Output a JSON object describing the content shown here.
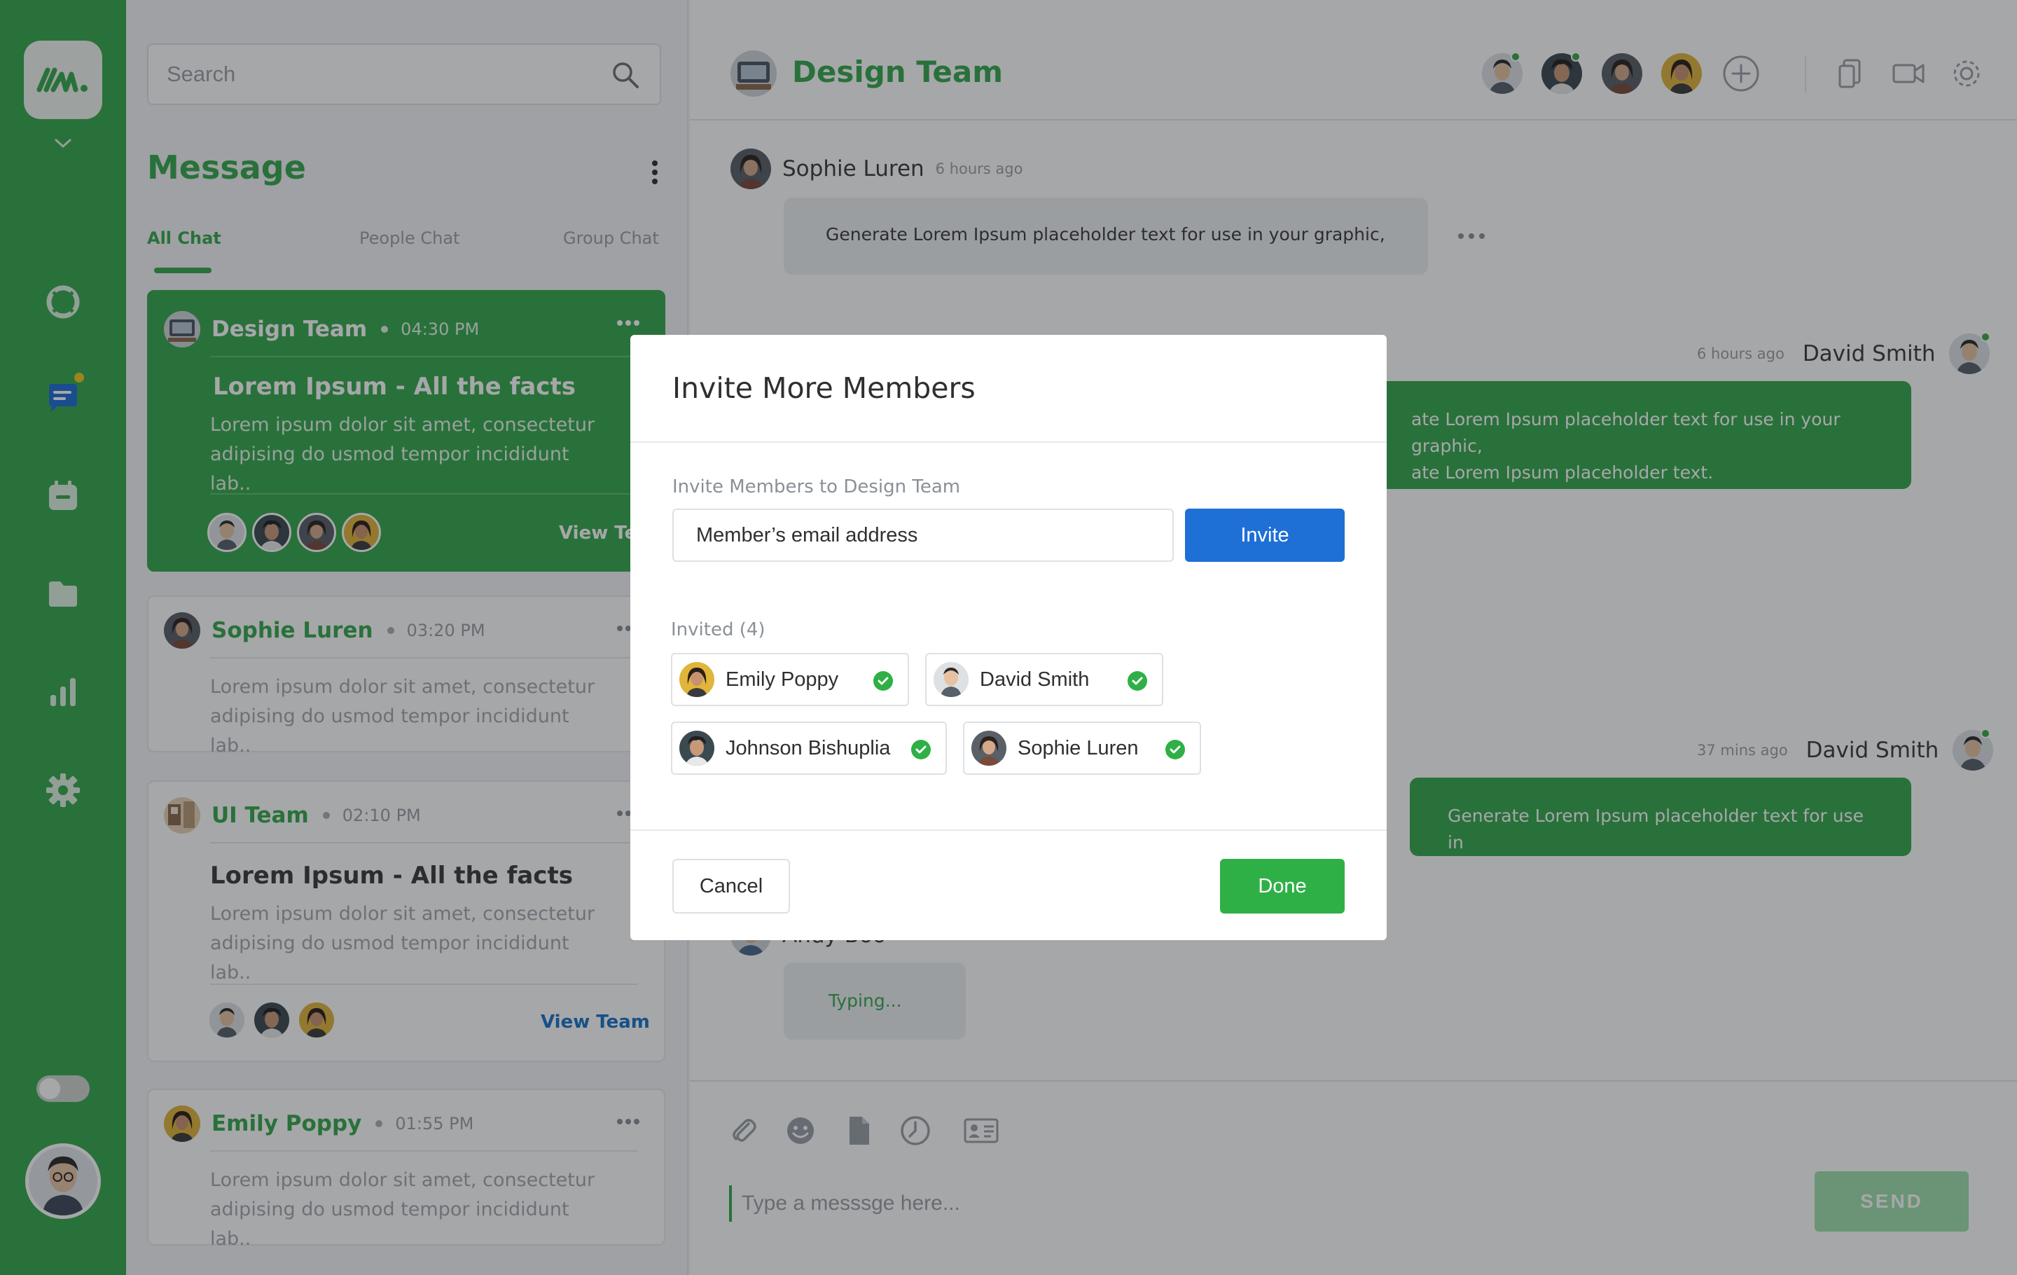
{
  "app": {
    "brand_color": "#36a84d",
    "accent_blue": "#1e6fd6"
  },
  "rail": {
    "logo": "brand-logo",
    "icons": [
      "support-icon",
      "chat-icon",
      "calendar-icon",
      "folder-icon",
      "chart-icon",
      "gear-icon"
    ],
    "active": "chat-icon",
    "theme_toggle": "off"
  },
  "sidebar": {
    "search_placeholder": "Search",
    "title": "Message",
    "tabs": [
      {
        "label": "All Chat",
        "active": true
      },
      {
        "label": "People Chat",
        "active": false
      },
      {
        "label": "Group Chat",
        "active": false
      }
    ],
    "cards": [
      {
        "name": "Design Team",
        "time": "04:30 PM",
        "subject": "Lorem Ipsum - All the facts",
        "body": "Lorem ipsum dolor sit amet, consectetur adipising do usmod tempor incididunt lab..",
        "link": "View Team",
        "active": true
      },
      {
        "name": "Sophie Luren",
        "time": "03:20 PM",
        "body": "Lorem ipsum dolor sit amet, consectetur adipising do usmod tempor incididunt lab.."
      },
      {
        "name": "UI Team",
        "time": "02:10 PM",
        "subject": "Lorem Ipsum - All the facts",
        "body": "Lorem ipsum dolor sit amet, consectetur adipising do usmod tempor incididunt lab..",
        "link": "View Team"
      },
      {
        "name": "Emily Poppy",
        "time": "01:55 PM",
        "body": "Lorem ipsum dolor sit amet, consectetur adipising do usmod tempor incididunt lab.."
      }
    ]
  },
  "chat": {
    "title": "Design Team",
    "header_icons": [
      "add-member-icon",
      "copy-icon",
      "video-icon",
      "settings-icon"
    ],
    "messages": [
      {
        "sender": "Sophie Luren",
        "ago": "6 hours ago",
        "text": "Generate Lorem Ipsum placeholder text for use in your graphic,"
      },
      {
        "sender": "David Smith",
        "ago": "6 hours ago",
        "line1": "ate Lorem Ipsum placeholder text for use in your graphic,",
        "line2": "ate Lorem Ipsum placeholder text."
      },
      {
        "sender": "David Smith",
        "ago": "37 mins ago",
        "text": "Generate Lorem Ipsum placeholder text for use in"
      },
      {
        "sender": "Andy Boo",
        "text": "Typing..."
      }
    ],
    "composer_placeholder": "Type a messsge here...",
    "send_label": "SEND",
    "composer_tools": [
      "paperclip-icon",
      "emoji-icon",
      "file-icon",
      "clock-icon",
      "contact-card-icon"
    ]
  },
  "modal": {
    "title": "Invite More Members",
    "label": "Invite Members to Design Team",
    "email_placeholder": "Member’s email address",
    "invite_label": "Invite",
    "invited_label": "Invited",
    "invited_count": "(4)",
    "invited": [
      "Emily Poppy",
      "David Smith",
      "Johnson Bishuplia",
      "Sophie Luren"
    ],
    "cancel_label": "Cancel",
    "done_label": "Done"
  }
}
